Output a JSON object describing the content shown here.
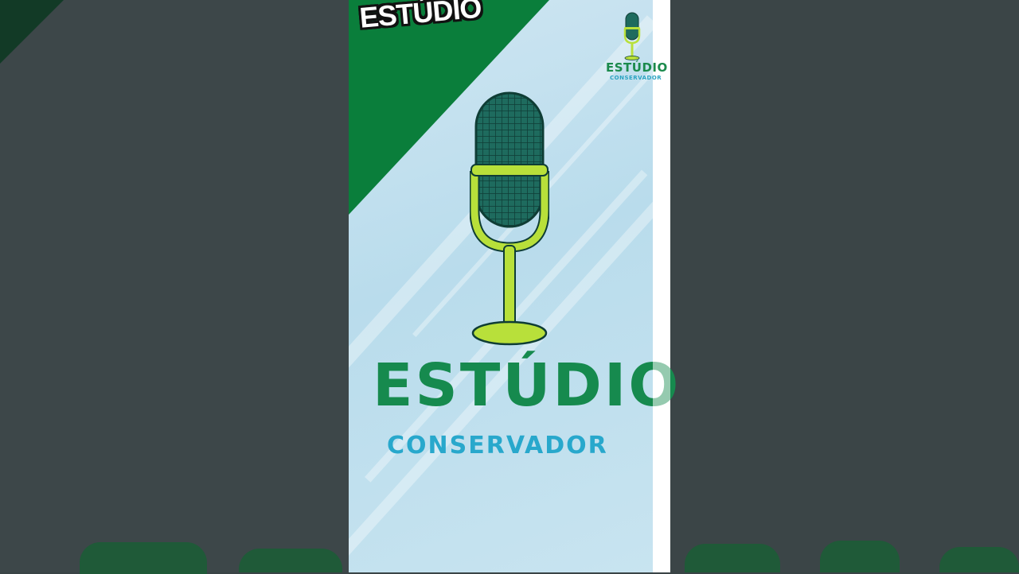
{
  "corner_label": "ESTÚDIO",
  "logo": {
    "title": "ESTÚDIO",
    "subtitle": "CONSERVADOR"
  },
  "small_logo": {
    "title": "ESTÚDIO",
    "subtitle": "CONSERVADOR"
  },
  "colors": {
    "brand_green": "#0a7e3b",
    "title_green": "#168a4e",
    "subtitle_blue": "#28a8cc",
    "mic_head": "#1e6b5e",
    "mic_stand": "#b8e03a"
  },
  "icons": [
    "microphone-icon",
    "small-microphone-icon"
  ]
}
